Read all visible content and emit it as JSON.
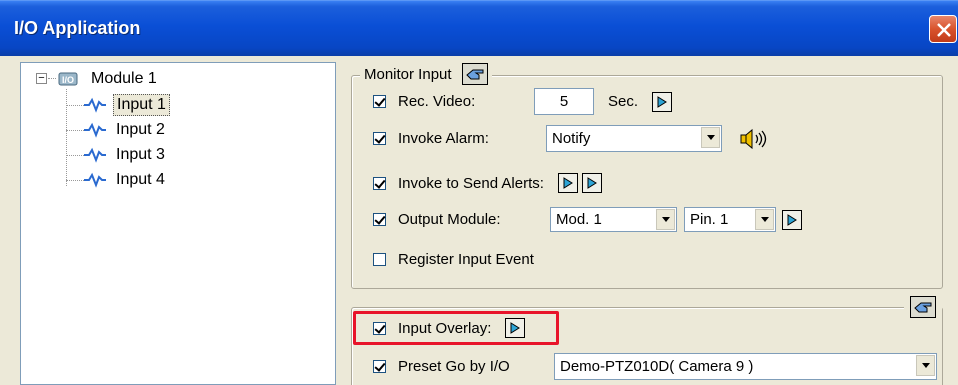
{
  "window": {
    "title": "I/O Application"
  },
  "tree": {
    "root": "Module 1",
    "inputs": [
      "Input 1",
      "Input 2",
      "Input 3",
      "Input 4"
    ],
    "selected": "Input 1"
  },
  "monitor_input": {
    "title": "Monitor Input",
    "rec_video": {
      "label": "Rec. Video:",
      "checked": true,
      "value": "5",
      "unit": "Sec."
    },
    "invoke_alarm": {
      "label": "Invoke Alarm:",
      "checked": true,
      "selected": "Notify"
    },
    "invoke_alerts": {
      "label": "Invoke to Send Alerts:",
      "checked": true
    },
    "output_module": {
      "label": "Output Module:",
      "checked": true,
      "module": "Mod. 1",
      "pin": "Pin. 1"
    },
    "register_event": {
      "label": "Register Input Event",
      "checked": false
    }
  },
  "overlay": {
    "input_overlay": {
      "label": "Input Overlay:",
      "checked": true
    },
    "preset_go": {
      "label": "Preset Go by I/O",
      "checked": true,
      "selected": "Demo-PTZ010D( Camera 9 )"
    }
  },
  "colors": {
    "titlebar": "#0a4fd6",
    "highlight": "#e8142a",
    "background": "#ece9d8"
  }
}
